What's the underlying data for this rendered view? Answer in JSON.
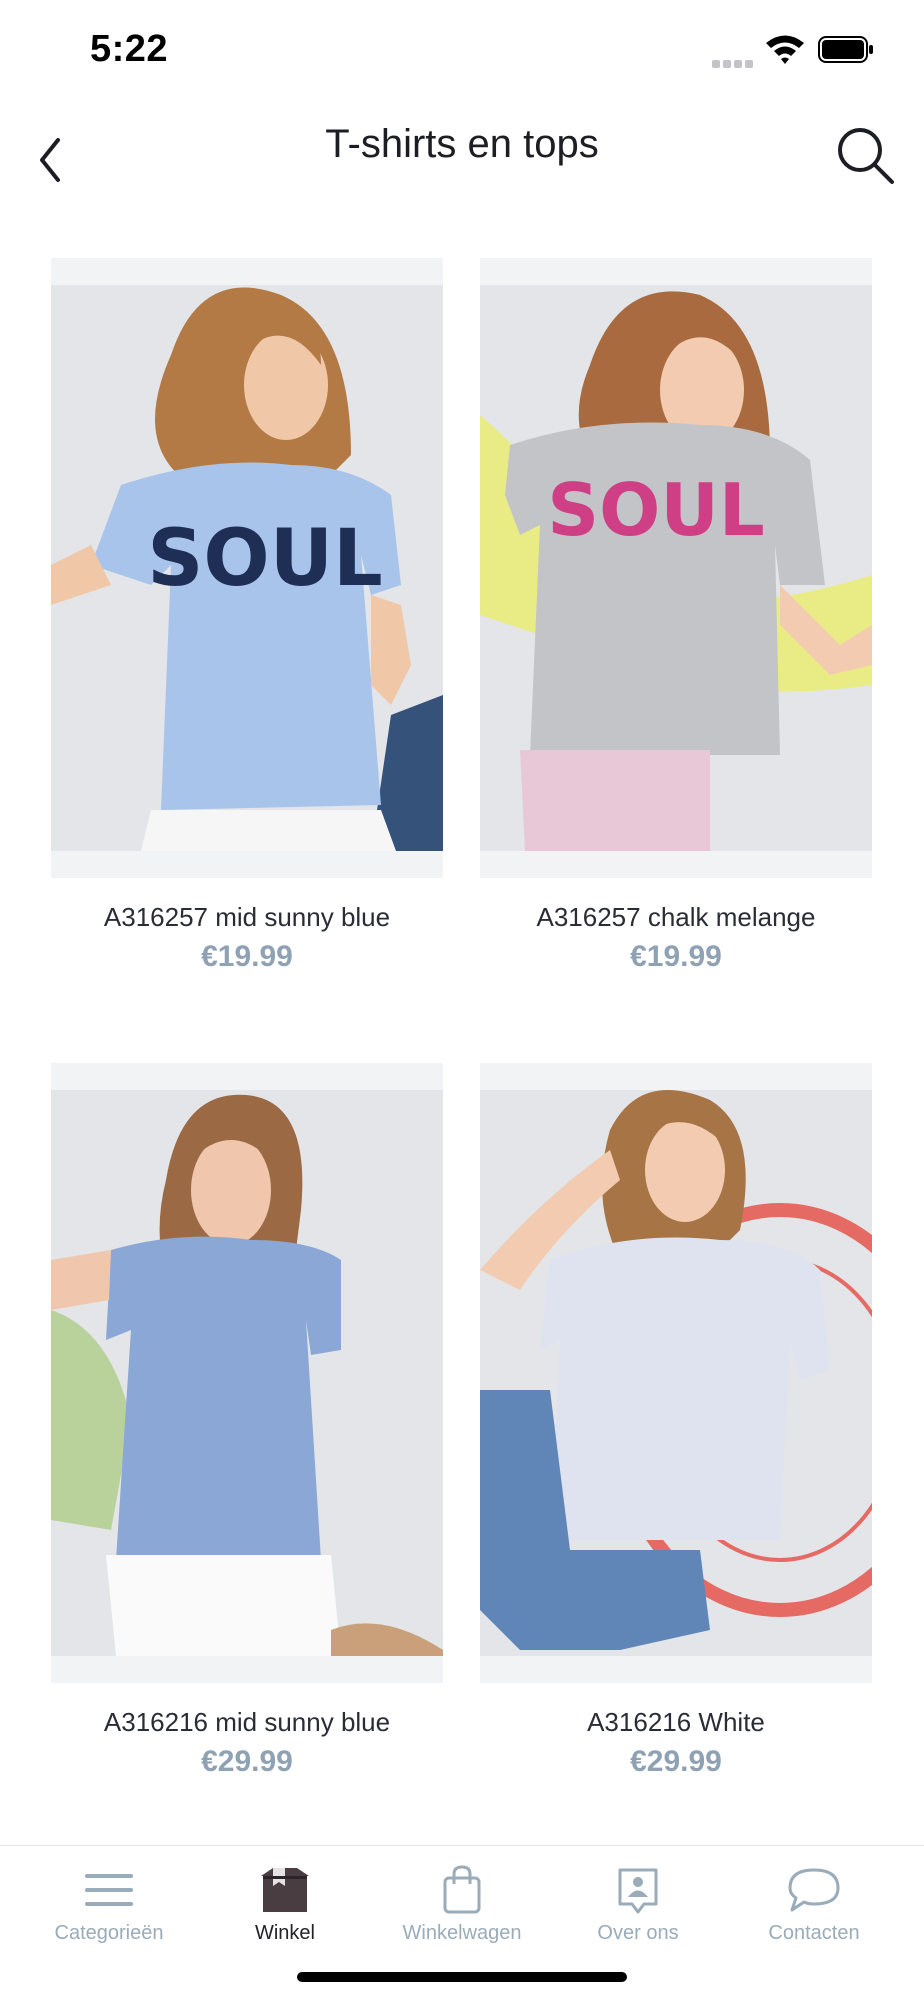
{
  "status_bar": {
    "time": "5:22"
  },
  "header": {
    "title": "T-shirts en tops"
  },
  "products": [
    {
      "name": "A316257 mid sunny blue",
      "price": "€19.99",
      "shirt_color": "#a8c4ea",
      "print": "SOUL",
      "print_color": "#1f2e55"
    },
    {
      "name": "A316257 chalk melange",
      "price": "€19.99",
      "shirt_color": "#c3c4c7",
      "print": "SOUL",
      "print_color": "#cf3f86"
    },
    {
      "name": "A316216 mid sunny blue",
      "price": "€29.99",
      "shirt_color": "#8aa7d6"
    },
    {
      "name": "A316216 White",
      "price": "€29.99",
      "shirt_color": "#dfe3ef"
    }
  ],
  "tab_bar": {
    "tabs": [
      {
        "label": "Categorieën",
        "icon": "menu-icon",
        "active": false
      },
      {
        "label": "Winkel",
        "icon": "store-icon",
        "active": true
      },
      {
        "label": "Winkelwagen",
        "icon": "shopping-bag-icon",
        "active": false
      },
      {
        "label": "Over ons",
        "icon": "person-card-icon",
        "active": false
      },
      {
        "label": "Contacten",
        "icon": "chat-bubble-icon",
        "active": false
      }
    ]
  },
  "colors": {
    "price": "#8fa2b4",
    "tab_inactive": "#9aabb9",
    "tab_active": "#222228",
    "image_background": "#f2f3f5"
  }
}
